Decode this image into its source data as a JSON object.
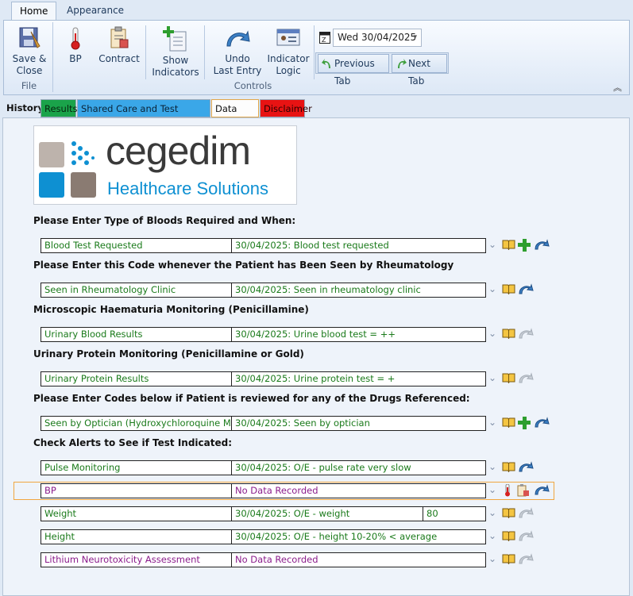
{
  "ribbon": {
    "tabs": [
      {
        "label": "Home",
        "active": true
      },
      {
        "label": "Appearance",
        "active": false
      }
    ],
    "groups": {
      "file": {
        "label": "File",
        "buttons": [
          {
            "label_line1": "Save &",
            "label_line2": "Close",
            "icon": "save-close-icon"
          }
        ]
      },
      "controls": {
        "label": "Controls",
        "buttons": [
          {
            "label_line1": "BP",
            "label_line2": "",
            "icon": "thermometer-icon"
          },
          {
            "label_line1": "Contract",
            "label_line2": "",
            "icon": "contract-clipboard-icon"
          },
          {
            "label_line1": "Show",
            "label_line2": "Indicators",
            "icon": "add-indicator-icon"
          },
          {
            "label_line1": "Undo",
            "label_line2": "Last Entry",
            "icon": "undo-arrow-icon"
          },
          {
            "label_line1": "Indicator",
            "label_line2": "Logic",
            "icon": "indicator-logic-icon"
          }
        ]
      }
    },
    "date_value": "Wed 30/04/2025",
    "previous_tab_label": "Previous Tab",
    "next_tab_label": "Next Tab"
  },
  "sub_tabs": [
    {
      "label": "History",
      "color": "#eef3fa"
    },
    {
      "label": "Results",
      "color": "#1aa34a"
    },
    {
      "label": "Shared Care and Test Frequency",
      "color": "#3aa7e8"
    },
    {
      "label": "Data Entry",
      "color": "#fdfdfd"
    },
    {
      "label": "Disclaimer",
      "color": "#e81313"
    }
  ],
  "logo": {
    "brand": "cegedim",
    "tagline": "Healthcare Solutions"
  },
  "sections": [
    {
      "heading": "Please Enter Type of Bloods Required and When:"
    },
    {
      "heading": "Please Enter this Code whenever the Patient has Been Seen by Rheumatology"
    },
    {
      "heading": "Microscopic Haematuria Monitoring (Penicillamine)"
    },
    {
      "heading": "Urinary Protein Monitoring (Penicillamine or Gold)"
    },
    {
      "heading": "Please Enter Codes below if Patient is reviewed for any of the Drugs Referenced:"
    },
    {
      "heading": "Check Alerts to See if Test Indicated:"
    }
  ],
  "rows": [
    {
      "name": "Blood Test Requested",
      "value": "30/04/2025: Blood test requested",
      "extra": "",
      "has_data": true
    },
    {
      "name": "Seen in Rheumatology Clinic",
      "value": "30/04/2025: Seen in rheumatology clinic",
      "extra": "",
      "has_data": true
    },
    {
      "name": "Urinary Blood Results",
      "value": "30/04/2025: Urine blood test = ++",
      "extra": "",
      "has_data": true
    },
    {
      "name": "Urinary Protein Results",
      "value": "30/04/2025: Urine protein test = +",
      "extra": "",
      "has_data": true
    },
    {
      "name": "Seen by Optician (Hydroxychloroquine Monitori...",
      "value": "30/04/2025: Seen by optician",
      "extra": "",
      "has_data": true
    },
    {
      "name": "Pulse Monitoring",
      "value": "30/04/2025: O/E - pulse rate very slow",
      "extra": "",
      "has_data": true
    },
    {
      "name": "BP",
      "value": "No Data Recorded",
      "extra": "",
      "has_data": false
    },
    {
      "name": "Weight",
      "value": "30/04/2025: O/E - weight",
      "extra": "80",
      "has_data": true
    },
    {
      "name": "Height",
      "value": "30/04/2025: O/E - height 10-20% < average",
      "extra": "",
      "has_data": true
    },
    {
      "name": "Lithium Neurotoxicity Assessment",
      "value": "No Data Recorded",
      "extra": "",
      "has_data": false
    }
  ],
  "icon_glyphs": {
    "dropdown": "⌄"
  }
}
